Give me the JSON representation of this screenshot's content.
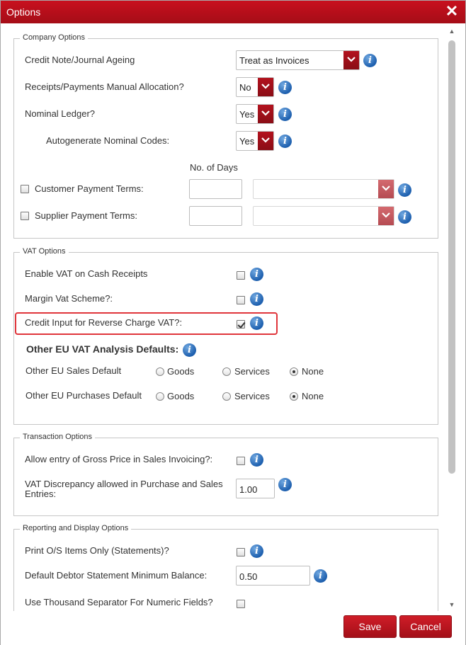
{
  "window": {
    "title": "Options"
  },
  "company": {
    "legend": "Company Options",
    "credit_note_label": "Credit Note/Journal Ageing",
    "credit_note_value": "Treat as Invoices",
    "receipts_label": "Receipts/Payments Manual Allocation?",
    "receipts_value": "No",
    "nominal_label": "Nominal Ledger?",
    "nominal_value": "Yes",
    "autogen_label": "Autogenerate Nominal Codes:",
    "autogen_value": "Yes",
    "days_header": "No. of Days",
    "customer_terms_label": "Customer Payment Terms:",
    "supplier_terms_label": "Supplier Payment Terms:"
  },
  "vat": {
    "legend": "VAT Options",
    "cash_receipts_label": "Enable VAT on Cash Receipts",
    "margin_label": "Margin Vat Scheme?:",
    "reverse_charge_label": "Credit Input for Reverse Charge VAT?:",
    "eu_header": "Other EU VAT Analysis Defaults:",
    "eu_sales_label": "Other EU Sales Default",
    "eu_purchases_label": "Other EU Purchases Default",
    "opt_goods": "Goods",
    "opt_services": "Services",
    "opt_none": "None"
  },
  "transaction": {
    "legend": "Transaction Options",
    "gross_price_label": "Allow entry of Gross Price in Sales Invoicing?:",
    "discrepancy_label_line1": "VAT Discrepancy allowed in Purchase and Sales",
    "discrepancy_label_line2": "Entries:",
    "discrepancy_value": "1.00"
  },
  "reporting": {
    "legend": "Reporting and Display Options",
    "os_items_label": "Print O/S Items Only (Statements)?",
    "min_balance_label": "Default Debtor Statement Minimum Balance:",
    "min_balance_value": "0.50",
    "thousand_sep_label": "Use Thousand Separator For Numeric Fields?"
  },
  "footer": {
    "save_label": "Save",
    "cancel_label": "Cancel"
  },
  "colors": {
    "accent": "#c8101e",
    "info": "#1d5fae",
    "highlight": "#e0353b"
  }
}
